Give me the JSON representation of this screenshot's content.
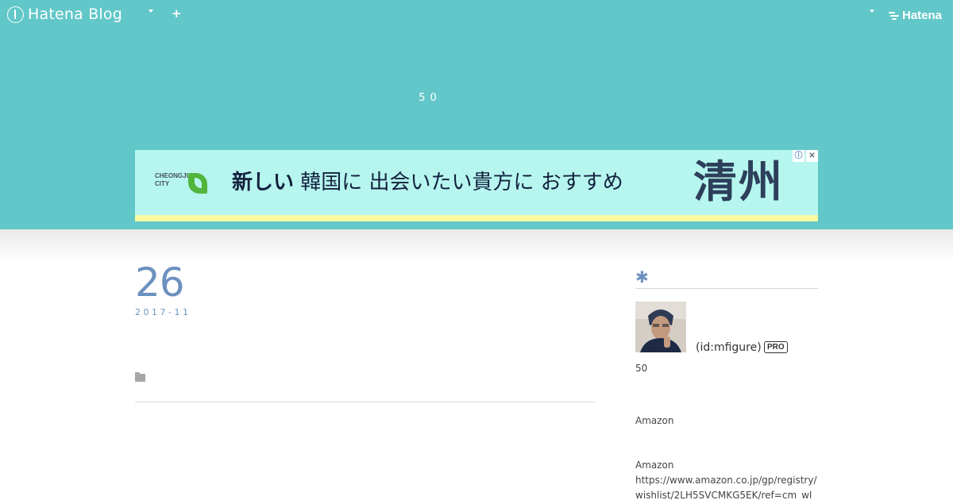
{
  "nav": {
    "brand": "Hatena Blog",
    "add_symbol": "+",
    "hatena_label": "Hatena"
  },
  "blog": {
    "title": "50"
  },
  "ad": {
    "city_line1": "CHEONGJU",
    "city_line2": "CITY",
    "copy_bold": "新しい",
    "copy_rest": "韓国に 出会いたい貴方に おすすめ",
    "headline": "清州",
    "info_symbol": "ⓘ",
    "close_symbol": "✕",
    "colors": {
      "background": "#b6f6ef",
      "stripe": "#fbf9a0"
    }
  },
  "entry": {
    "day": "26",
    "year_month": "2017-11"
  },
  "sidebar": {
    "section_icon": "✱",
    "user_id": "(id:mfigure)",
    "pro_label": "PRO",
    "description": "50",
    "amazon_heading": "Amazon",
    "amazon_label": "Amazon",
    "amazon_url": "https://www.amazon.co.jp/gp/registry/wishlist/2LH5SVCMKG5EK/ref=cm_wl_"
  },
  "theme": {
    "header_color": "#62c7c8",
    "accent_color": "#6c91bf"
  }
}
